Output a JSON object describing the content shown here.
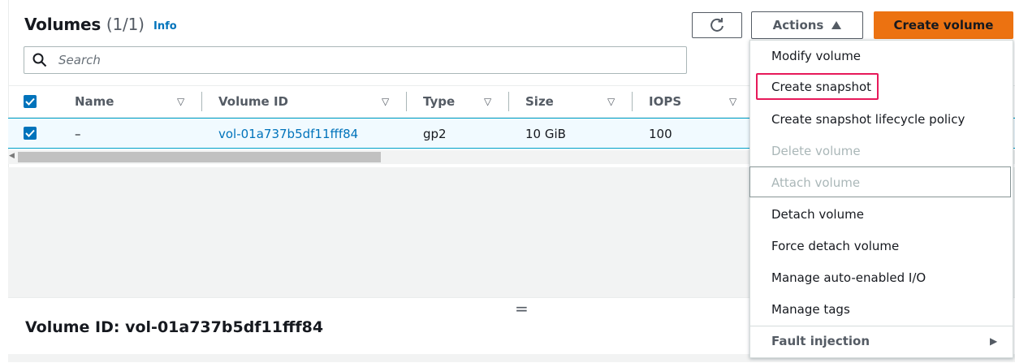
{
  "header": {
    "title": "Volumes",
    "count": "(1/1)",
    "info_link": "Info",
    "refresh_icon": "refresh-icon",
    "actions_label": "Actions",
    "create_label": "Create volume",
    "accent_color": "#ec7211"
  },
  "search": {
    "placeholder": "Search"
  },
  "table": {
    "columns": [
      "Name",
      "Volume ID",
      "Type",
      "Size",
      "IOPS"
    ],
    "rows": [
      {
        "selected": true,
        "name": "–",
        "volume_id": "vol-01a737b5df11fff84",
        "type": "gp2",
        "size": "10 GiB",
        "iops": "100"
      }
    ]
  },
  "details": {
    "title": "Volume ID: vol-01a737b5df11fff84",
    "resize_handle": "="
  },
  "actions_menu": {
    "items": [
      {
        "label": "Modify volume",
        "disabled": false
      },
      {
        "label": "Create snapshot",
        "disabled": false,
        "highlighted": true
      },
      {
        "label": "Create snapshot lifecycle policy",
        "disabled": false
      },
      {
        "label": "Delete volume",
        "disabled": true
      },
      {
        "label": "Attach volume",
        "disabled": true
      },
      {
        "label": "Detach volume",
        "disabled": false
      },
      {
        "label": "Force detach volume",
        "disabled": false
      },
      {
        "label": "Manage auto-enabled I/O",
        "disabled": false
      },
      {
        "label": "Manage tags",
        "disabled": false
      },
      {
        "label": "Fault injection",
        "disabled": false,
        "submenu": true
      }
    ],
    "highlight_color": "#e7195a"
  }
}
